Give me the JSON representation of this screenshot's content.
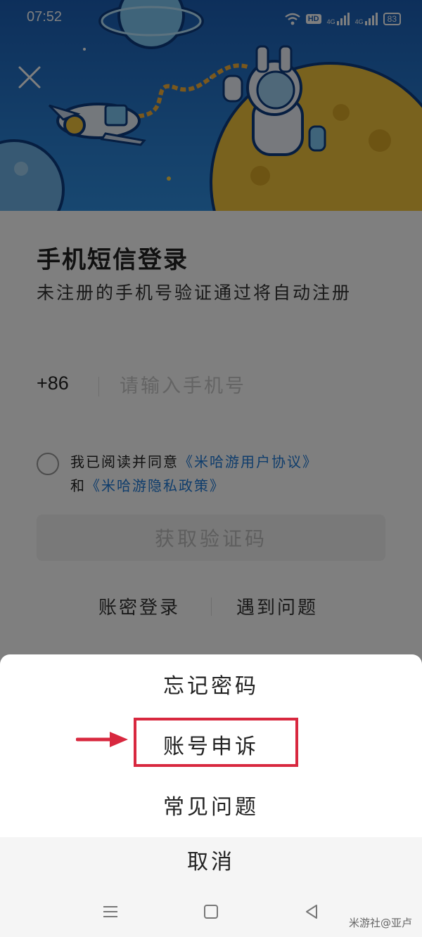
{
  "status_bar": {
    "time": "07:52",
    "hd": "HD",
    "signal1": "4G",
    "signal2": "4G",
    "battery": "83"
  },
  "login": {
    "title": "手机短信登录",
    "subtitle": "未注册的手机号验证通过将自动注册",
    "country_code": "+86",
    "phone_placeholder": "请输入手机号",
    "agree_prefix": "我已阅读并同意",
    "user_agreement": "《米哈游用户协议》",
    "agree_and": "和",
    "privacy_policy": "《米哈游隐私政策》",
    "get_code_label": "获取验证码",
    "password_login": "账密登录",
    "problem": "遇到问题"
  },
  "sheet": {
    "forgot_password": "忘记密码",
    "account_appeal": "账号申诉",
    "faq": "常见问题",
    "cancel": "取消"
  },
  "watermark": "米游社@亚卢",
  "colors": {
    "accent": "#1f7ad8",
    "highlight": "#d8283f",
    "hero_blue": "#1b5fb6"
  }
}
